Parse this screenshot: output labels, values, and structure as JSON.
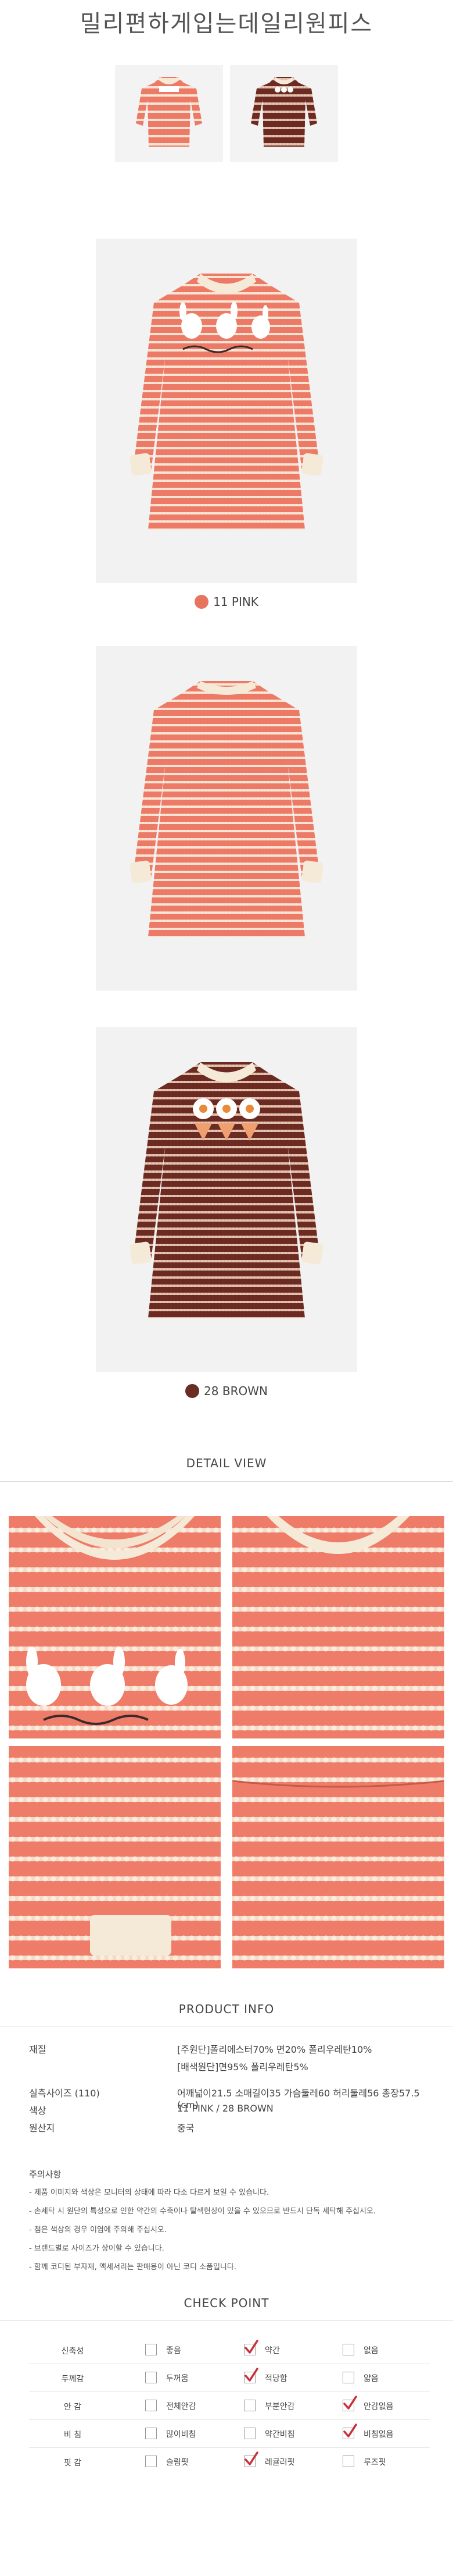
{
  "page": {
    "title": "밀리편하게입는데일리원피스"
  },
  "colors": {
    "pink": "#e67560",
    "brown": "#6a2d23",
    "cream": "#f5ead8",
    "check": "#c8303a"
  },
  "captions": {
    "pink": "11 PINK",
    "brown": "28 BROWN"
  },
  "sections": {
    "detail": "DETAIL VIEW",
    "product_info": "PRODUCT INFO",
    "check_point": "CHECK POINT"
  },
  "product_info": {
    "rows": [
      {
        "label": "재질",
        "value": "[주원단]폴리에스터70% 면20% 폴리우레탄10%"
      },
      {
        "label": "",
        "value": "[배색원단]면95% 폴리우레탄5%"
      },
      {
        "label": "실측사이즈 (110)",
        "value": "어깨넓이21.5 소매길이35 가슴둘레60 허리둘레56 총장57.5 (cm)"
      },
      {
        "label": "색상",
        "value": "11 PINK / 28 BROWN"
      },
      {
        "label": "원산지",
        "value": "중국"
      }
    ]
  },
  "notes": {
    "title": "주의사항",
    "items": [
      "- 제품 이미지와 색상은 모니터의 상태에 따라 다소 다르게 보일 수 있습니다.",
      "- 손세탁 시 원단의 특성으로 인한 약간의 수축이나 탈색현상이 있을 수 있으므로 반드시 단독 세탁해 주십시오.",
      "- 첨은 색상의 경우 이염에 주의해 주십시오.",
      "- 브랜드별로 사이즈가 상이할 수 있습니다.",
      "- 함께 코디된 부자재, 액세서리는 판매용이 아닌 코디 소품입니다."
    ]
  },
  "check_point": {
    "rows": [
      {
        "label": "신축성",
        "options": [
          {
            "text": "좋음",
            "checked": false
          },
          {
            "text": "약간",
            "checked": true
          },
          {
            "text": "없음",
            "checked": false
          }
        ]
      },
      {
        "label": "두께감",
        "options": [
          {
            "text": "두꺼움",
            "checked": false
          },
          {
            "text": "적당함",
            "checked": true
          },
          {
            "text": "얇음",
            "checked": false
          }
        ]
      },
      {
        "label": "안 감",
        "options": [
          {
            "text": "전체안감",
            "checked": false
          },
          {
            "text": "부분안감",
            "checked": false
          },
          {
            "text": "안감없음",
            "checked": true
          }
        ]
      },
      {
        "label": "비 침",
        "options": [
          {
            "text": "많이비침",
            "checked": false
          },
          {
            "text": "약간비침",
            "checked": false
          },
          {
            "text": "비침없음",
            "checked": true
          }
        ]
      },
      {
        "label": "핏 감",
        "options": [
          {
            "text": "슬림핏",
            "checked": false
          },
          {
            "text": "레귤러핏",
            "checked": true
          },
          {
            "text": "루즈핏",
            "checked": false
          }
        ]
      }
    ]
  }
}
